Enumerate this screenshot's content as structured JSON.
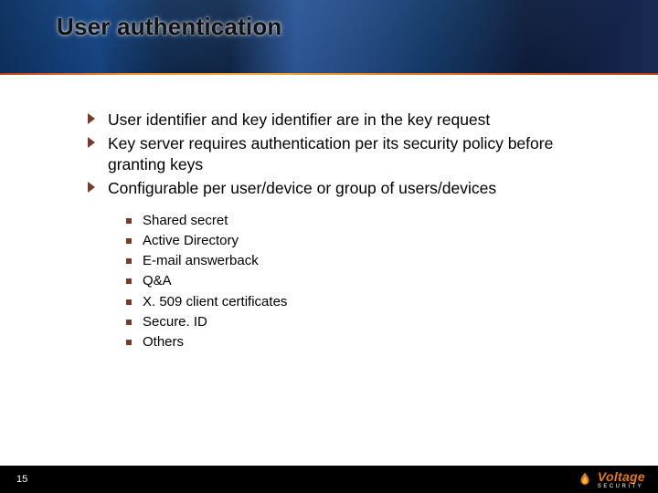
{
  "title": "User authentication",
  "bullets": [
    "User identifier and key identifier are in the key request",
    "Key server requires authentication per its security policy before granting keys",
    "Configurable per user/device or group of users/devices"
  ],
  "sub_bullets": [
    "Shared secret",
    "Active Directory",
    "E-mail answerback",
    "Q&A",
    "X. 509 client certificates",
    "Secure. ID",
    "Others"
  ],
  "page_number": "15",
  "logo": {
    "main": "Voltage",
    "sub": "SECURITY"
  }
}
